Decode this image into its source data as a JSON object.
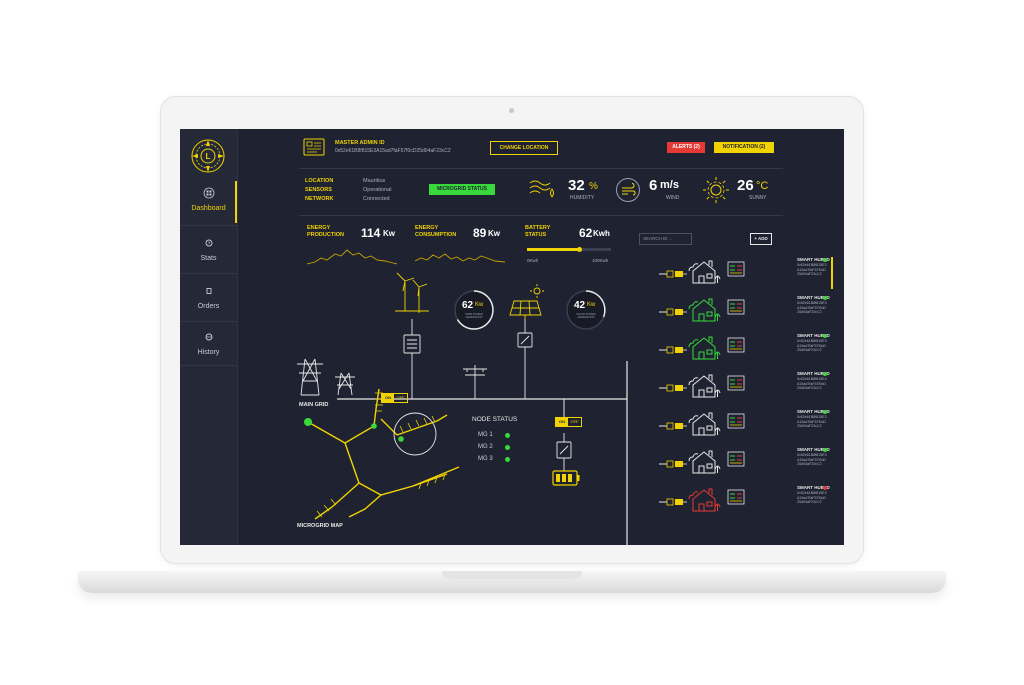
{
  "sidebar": {
    "logo_letter": "L",
    "items": [
      {
        "label": "Dashboard",
        "icon": "grid-icon",
        "active": true
      },
      {
        "label": "Stats",
        "icon": "clock-icon",
        "active": false
      },
      {
        "label": "Orders",
        "icon": "square-icon",
        "active": false
      },
      {
        "label": "History",
        "icon": "globe-icon",
        "active": false
      }
    ]
  },
  "header": {
    "admin_label": "MASTER ADMIN ID",
    "admin_id": "0x52e61B8f815E3A15ad7faF57f0cD25d04aF23cC2",
    "change_location": "CHANGE LOCATION",
    "alerts": "ALERTS (2)",
    "notification": "NOTIFICATION (2)"
  },
  "info": {
    "location_label": "LOCATION",
    "location_value": "Mauritius",
    "sensors_label": "SENSORS",
    "sensors_value": "Operational",
    "network_label": "NETWORK",
    "network_value": "Connected",
    "microgrid_status": "MICROGRID STATUS"
  },
  "weather": {
    "humidity_value": "32",
    "humidity_unit": "%",
    "humidity_label": "HUMIDITY",
    "wind_value": "6",
    "wind_unit": "m/s",
    "wind_label": "WIND",
    "temp_value": "26",
    "temp_unit": "°C",
    "temp_label": "SUNNY"
  },
  "energy": {
    "production_label_1": "ENERGY",
    "production_label_2": "PRODUCTION",
    "production_value": "114",
    "production_unit": "Kw",
    "consumption_label_1": "ENERGY",
    "consumption_label_2": "CONSUMPTION",
    "consumption_value": "89",
    "consumption_unit": "Kw",
    "battery_label_1": "BATTERY",
    "battery_label_2": "STATUS",
    "battery_value": "62",
    "battery_unit": "Kwh",
    "battery_min": "0Kwh",
    "battery_max": "100Kwh",
    "battery_level": 0.62
  },
  "grid": {
    "wind_gauge_value": "62",
    "wind_gauge_unit": "Kw",
    "wind_gauge_caption": "WIND POWER GENERATION",
    "solar_gauge_value": "42",
    "solar_gauge_unit": "Kw",
    "solar_gauge_caption": "SOLAR POWER GENERATION",
    "main_grid_label": "MAIN GRID",
    "on_label": "ON",
    "off_label": "OFF",
    "microgrid_map_label": "MICROGRID MAP",
    "node_status_title": "NODE STATUS",
    "nodes": [
      "MG 1",
      "MG 2",
      "MG 3"
    ]
  },
  "hubs": {
    "search_placeholder": "SEARCH ID ...",
    "add_label": "+ ADD",
    "items": [
      {
        "label": "SMART HUB ID",
        "id": "0x52e61B8f815E3A15ad7faF57f0cD25d04aF23cC2",
        "status_color": "#39d93b",
        "house_color": "#e8e8e8"
      },
      {
        "label": "SMART HUB ID",
        "id": "0x52e61B8f815E3A15ad7faF57f0cD25d04aF23cC2",
        "status_color": "#39d93b",
        "house_color": "#39d93b"
      },
      {
        "label": "SMART HUB ID",
        "id": "0x52e61B8f815E3A15ad7faF57f0cD25d04aF23cC2",
        "status_color": "#39d93b",
        "house_color": "#39d93b"
      },
      {
        "label": "SMART HUB ID",
        "id": "0x52e61B8f815E3A15ad7faF57f0cD25d04aF23cC2",
        "status_color": "#39d93b",
        "house_color": "#e8e8e8"
      },
      {
        "label": "SMART HUB ID",
        "id": "0x52e61B8f815E3A15ad7faF57f0cD25d04aF23cC2",
        "status_color": "#39d93b",
        "house_color": "#e8e8e8"
      },
      {
        "label": "SMART HUB ID",
        "id": "0x52e61B8f815E3A15ad7faF57f0cD25d04aF23cC2",
        "status_color": "#39d93b",
        "house_color": "#e8e8e8"
      },
      {
        "label": "SMART HUB ID",
        "id": "0x52e61B8f815E3A15ad7faF57f0cD25d04aF23cC2",
        "status_color": "#e53935",
        "house_color": "#e53935"
      }
    ]
  },
  "colors": {
    "accent": "#f0d300",
    "ok": "#39d93b",
    "alert": "#e53935",
    "background": "#1f2230"
  }
}
